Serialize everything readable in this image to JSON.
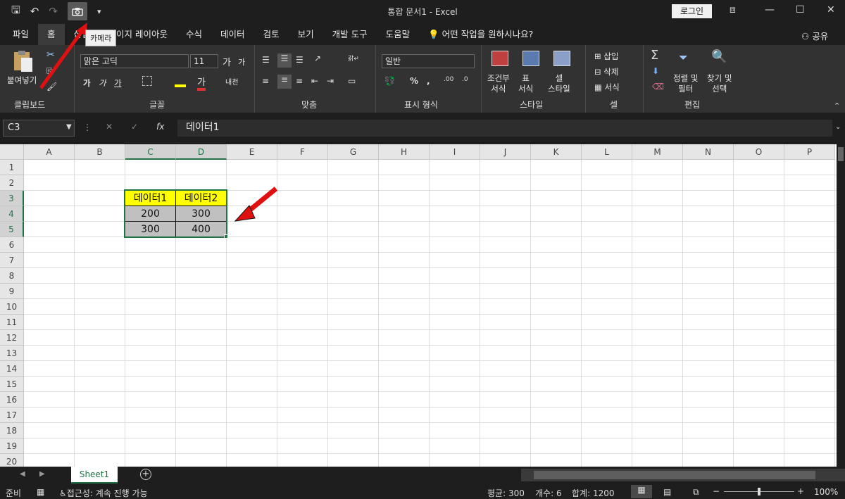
{
  "window": {
    "title": "통합 문서1  -  Excel",
    "login": "로그인",
    "camera_tooltip": "카메라"
  },
  "menu": {
    "items": [
      "파일",
      "홈",
      "삽입",
      "페이지 레이아웃",
      "수식",
      "데이터",
      "검토",
      "보기",
      "개발 도구",
      "도움말"
    ],
    "tell_me": "어떤 작업을 원하시나요?",
    "share": "공유"
  },
  "ribbon": {
    "clipboard": {
      "paste": "붙여넣기",
      "label": "클립보드"
    },
    "font": {
      "name": "맑은 고딕",
      "size": "11",
      "label": "글꼴"
    },
    "alignment": {
      "label": "맞춤"
    },
    "number": {
      "format": "일반",
      "label": "표시 형식"
    },
    "styles": {
      "conditional": "조건부\n서식",
      "table": "표\n서식",
      "cell": "셀\n스타일",
      "label": "스타일"
    },
    "cells": {
      "insert": "삽입",
      "delete": "삭제",
      "format": "서식",
      "label": "셀"
    },
    "editing": {
      "sort": "정렬 및\n필터",
      "find": "찾기 및\n선택",
      "label": "편집"
    }
  },
  "formula_bar": {
    "name_box": "C3",
    "formula": "데이터1"
  },
  "sheet": {
    "columns": [
      "A",
      "B",
      "C",
      "D",
      "E",
      "F",
      "G",
      "H",
      "I",
      "J",
      "K",
      "L",
      "M",
      "N",
      "O",
      "P"
    ],
    "rows": [
      "1",
      "2",
      "3",
      "4",
      "5",
      "6",
      "7",
      "8",
      "9",
      "10",
      "11",
      "12",
      "13",
      "14",
      "15",
      "16",
      "17",
      "18",
      "19",
      "20"
    ],
    "cells": {
      "C3": "데이터1",
      "D3": "데이터2",
      "C4": "200",
      "D4": "300",
      "C5": "300",
      "D5": "400"
    },
    "header_fill": "#ffff00",
    "data_fill": "#c0c0c0"
  },
  "tabs": {
    "sheet1": "Sheet1"
  },
  "status": {
    "ready": "준비",
    "accessibility": "접근성: 계속 진행 가능",
    "average": "평균: 300",
    "count": "개수: 6",
    "sum": "합계: 1200",
    "zoom": "100%"
  }
}
